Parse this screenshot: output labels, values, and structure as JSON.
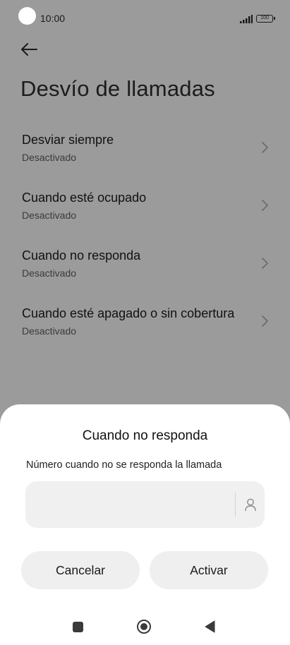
{
  "status_bar": {
    "time": "10:00",
    "battery": "100"
  },
  "header": {
    "title": "Desvío de llamadas"
  },
  "list": {
    "items": [
      {
        "title": "Desviar siempre",
        "subtitle": "Desactivado"
      },
      {
        "title": "Cuando esté ocupado",
        "subtitle": "Desactivado"
      },
      {
        "title": "Cuando no responda",
        "subtitle": "Desactivado"
      },
      {
        "title": "Cuando esté apagado o sin cobertura",
        "subtitle": "Desactivado"
      }
    ]
  },
  "dialog": {
    "title": "Cuando no responda",
    "label": "Número cuando no se responda la llamada",
    "input_value": "",
    "cancel_label": "Cancelar",
    "activate_label": "Activar"
  },
  "icons": {
    "back": "back-arrow-icon",
    "chevron": "chevron-right-icon",
    "contact": "contact-person-icon",
    "signal": "signal-icon",
    "battery": "battery-icon"
  },
  "colors": {
    "scrim": "#9b9b9b",
    "sheet": "#ffffff",
    "button_bg": "#efefef",
    "input_bg": "#f0f0f0"
  }
}
